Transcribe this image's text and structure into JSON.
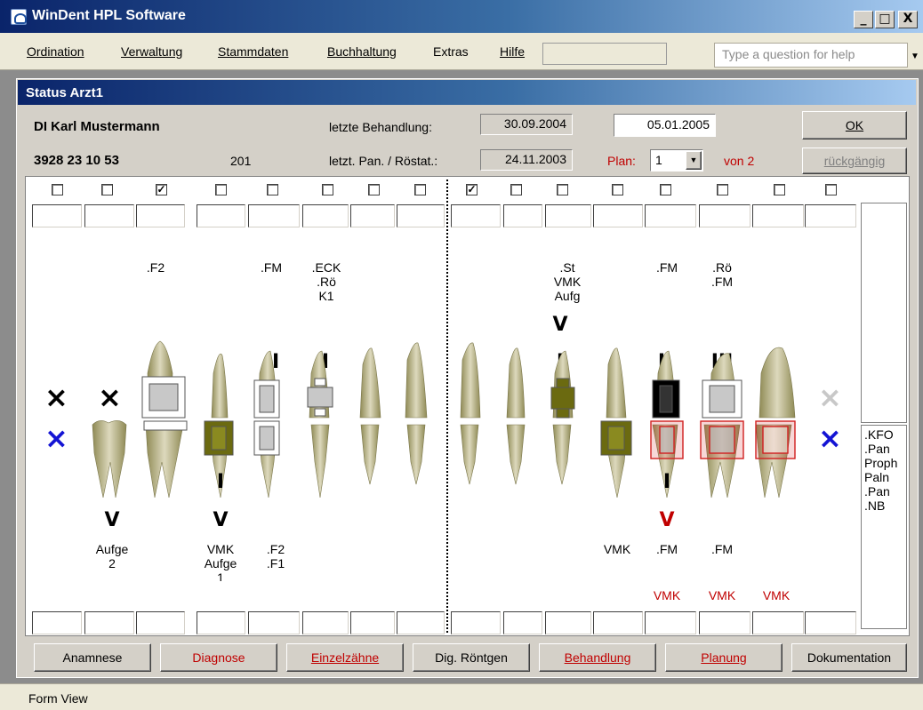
{
  "window": {
    "title": "WinDent  HPL Software",
    "min": "_",
    "max": "□",
    "close": "X"
  },
  "menu": {
    "items": [
      "Ordination",
      "Verwaltung",
      "Stammdaten",
      "Buchhaltung",
      "Extras",
      "Hilfe"
    ],
    "help_placeholder": "Type a question for help"
  },
  "form": {
    "title": "Status  Arzt1"
  },
  "patient": {
    "name": "DI Karl Mustermann",
    "number": "3928 23 10 53",
    "code": "201"
  },
  "fields": {
    "last_treatment_label": "letzte  Behandlung:",
    "last_treatment": "30.09.2004",
    "current_date": "05.01.2005",
    "last_pan_label": "letzt. Pan. / Röstat.:",
    "last_pan": "24.11.2003",
    "plan_label": "Plan:",
    "plan_value": "1",
    "plan_total": "von 2"
  },
  "buttons": {
    "ok": "OK",
    "undo": "rückgängig"
  },
  "upper_checks": [
    false,
    false,
    true,
    false,
    false,
    false,
    false,
    false,
    true,
    false,
    false,
    false,
    false,
    false,
    false,
    false
  ],
  "upper_notes": [
    {
      "t": ".F2"
    },
    {
      "t": ".FM"
    },
    {
      "t": ".ECK\n.Rö\nK1"
    },
    {
      "t": ".St\nVMK\nAufg"
    },
    {
      "t": ".FM"
    },
    {
      "t": ".Rö\n.FM"
    }
  ],
  "upper_roman": [
    "V",
    "II",
    "I",
    "I",
    "I",
    "III"
  ],
  "lower_roman": [
    "V",
    "I",
    "V",
    "I",
    "V"
  ],
  "lower_notes": [
    {
      "t": "Aufge\n2"
    },
    {
      "t": "VMK\nAufge\n1"
    },
    {
      "t": ".F2\n.F1"
    },
    {
      "t": "VMK"
    },
    {
      "t": ".FM"
    },
    {
      "t": ".FM"
    }
  ],
  "lower_red_notes": [
    "VMK",
    "VMK",
    "VMK"
  ],
  "side_list": [
    ".KFO",
    ".Pan",
    "Proph",
    "Paln",
    ".Pan",
    ".NB"
  ],
  "marks": {
    "x_black": "×",
    "x_blue": "×",
    "x_gray": "×"
  },
  "tabs": [
    "Anamnese",
    "Diagnose",
    "Einzelzähne",
    "Dig. Röntgen",
    "Behandlung",
    "Planung",
    "Dokumentation"
  ],
  "status": {
    "text": "Form View"
  },
  "colors": {
    "crown_olive": "#6b6a10",
    "tooth": "#c8c29a",
    "red_plan": "#d02020",
    "blue_x": "#1414d4"
  }
}
